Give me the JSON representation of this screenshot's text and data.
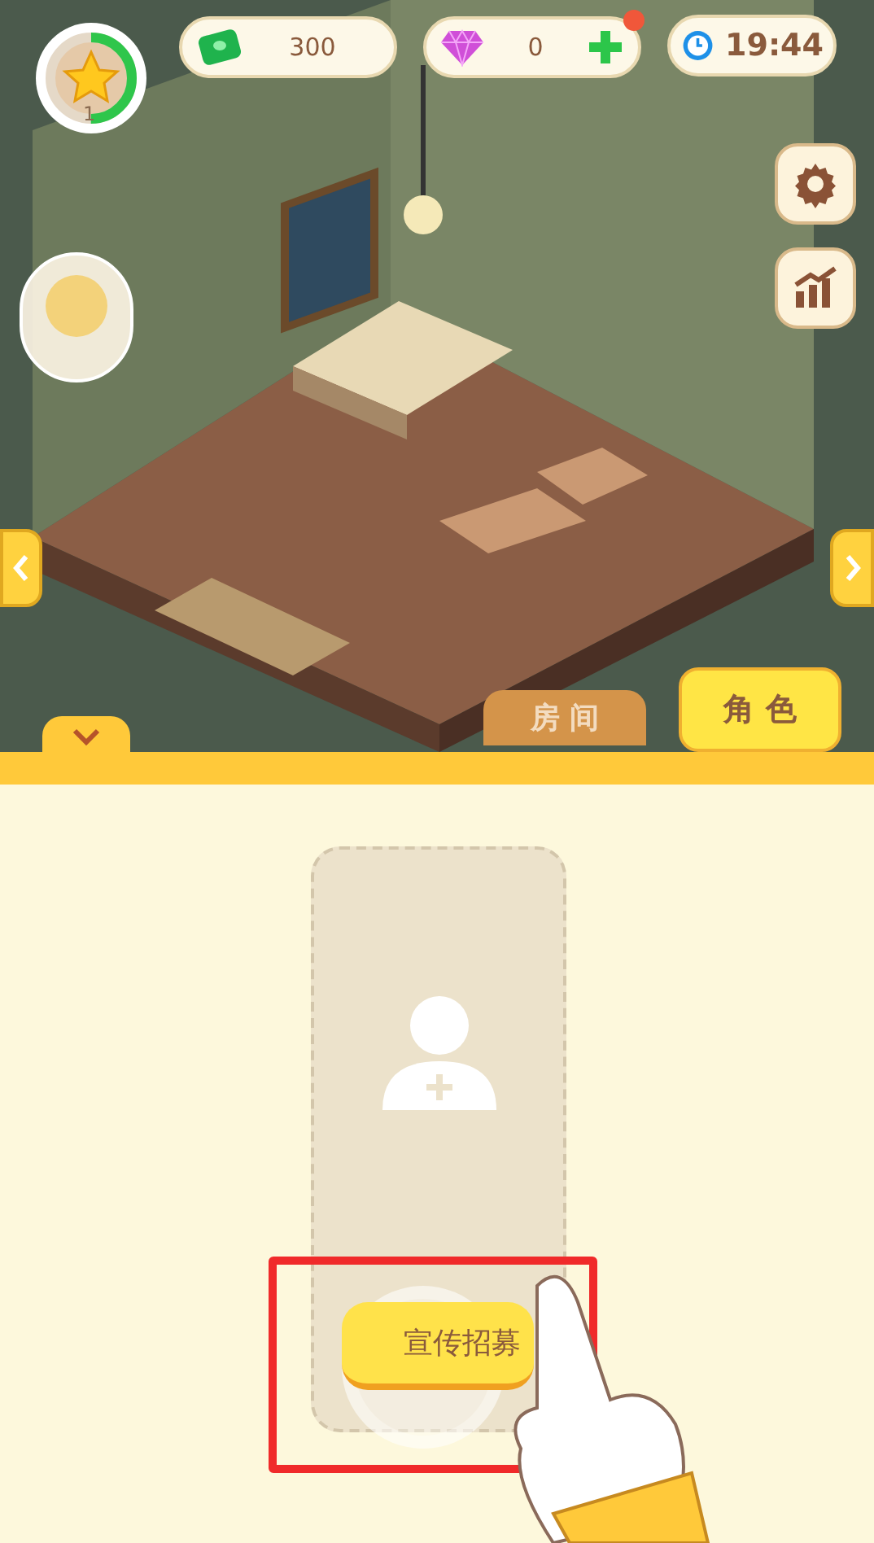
{
  "player": {
    "level": "1",
    "xp_ring": {
      "level": 0.5
    }
  },
  "currencies": [
    {
      "kind": "cash",
      "value": "300",
      "add_button": false,
      "notification": false
    },
    {
      "kind": "gem",
      "value": "0",
      "add_button": true,
      "notification": true
    }
  ],
  "clock": "19:44",
  "tabs": [
    {
      "label": "房间",
      "selected": false
    },
    {
      "label": "角色",
      "selected": true
    }
  ],
  "recruit_button": {
    "label": "宣传招募"
  }
}
